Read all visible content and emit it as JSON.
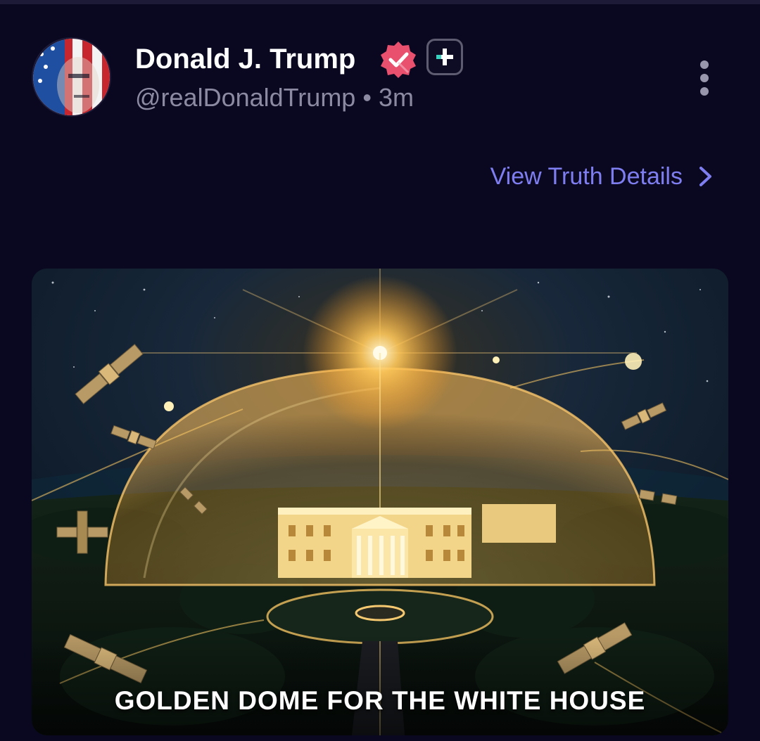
{
  "post": {
    "author": {
      "display_name": "Donald J. Trump",
      "handle": "@realDonaldTrump",
      "separator": "•",
      "timestamp": "3m",
      "verified_icon": "verified-badge-icon",
      "subscription_icon": "plus-badge-icon"
    },
    "more_icon": "vertical-ellipsis-icon",
    "details_link": {
      "label": "View Truth Details",
      "icon": "chevron-right-icon"
    },
    "media": {
      "caption": "GOLDEN DOME FOR THE WHITE HOUSE"
    }
  },
  "colors": {
    "background": "#0a0820",
    "link": "#7f7ef0",
    "verified": "#e8506e",
    "muted_text": "#8c8aa2"
  }
}
